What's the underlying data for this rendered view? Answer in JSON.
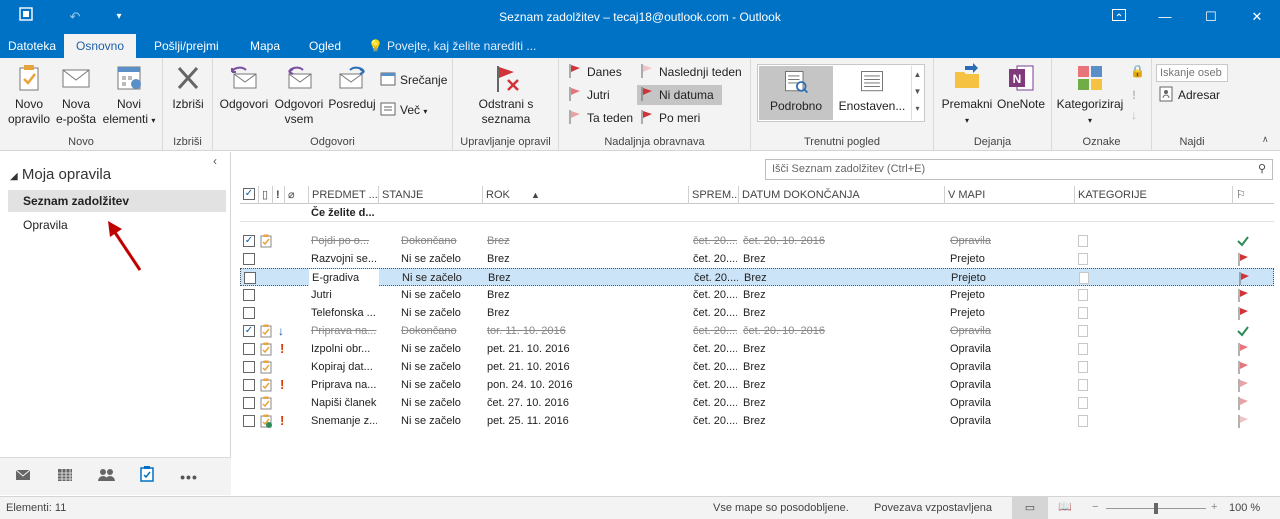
{
  "window": {
    "title": "Seznam zadolžitev – tecaj18@outlook.com - Outlook",
    "controls": [
      "restore-ribbon",
      "minimize",
      "maximize",
      "close"
    ]
  },
  "tabs": [
    "Datoteka",
    "Osnovno",
    "Pošlji/prejmi",
    "Mapa",
    "Ogled"
  ],
  "active_tab": "Osnovno",
  "tellme": "Povejte, kaj želite narediti ...",
  "ribbon": {
    "novo": {
      "label": "Novo",
      "new_task": "Novo opravilo",
      "new_task_1": "Novo",
      "new_task_2": "opravilo",
      "new_email_1": "Nova",
      "new_email_2": "e-pošta",
      "new_items_1": "Novi",
      "new_items_2": "elementi"
    },
    "izbrisi": {
      "label": "Izbriši",
      "delete": "Izbriši"
    },
    "odgovori": {
      "label": "Odgovori",
      "reply": "Odgovori",
      "reply_all_1": "Odgovori",
      "reply_all_2": "vsem",
      "forward": "Posreduj",
      "meeting": "Srečanje",
      "more": "Več"
    },
    "upravljanje": {
      "label": "Upravljanje opravil",
      "remove_1": "Odstrani s",
      "remove_2": "seznama"
    },
    "nadaljnja": {
      "label": "Nadaljnja obravnava",
      "today": "Danes",
      "tomorrow": "Jutri",
      "this_week": "Ta teden",
      "next_week": "Naslednji teden",
      "no_date": "Ni datuma",
      "custom": "Po meri"
    },
    "pogled": {
      "label": "Trenutni pogled",
      "detailed": "Podrobno",
      "simple": "Enostaven..."
    },
    "dejanja": {
      "label": "Dejanja",
      "move": "Premakni",
      "onenote": "OneNote"
    },
    "oznake": {
      "label": "Oznake",
      "categorize": "Kategoriziraj"
    },
    "najdi": {
      "label": "Najdi",
      "search_people_placeholder": "Iskanje oseb",
      "address_book": "Adresar"
    }
  },
  "leftnav": {
    "header": "Moja opravila",
    "items": [
      "Seznam zadolžitev",
      "Opravila"
    ],
    "selected": "Seznam zadolžitev",
    "bottom_icons": [
      "mail-icon",
      "calendar-icon",
      "people-icon",
      "tasks-icon",
      "more-icon"
    ]
  },
  "search": {
    "placeholder": "Išči Seznam zadolžitev (Ctrl+E)"
  },
  "table": {
    "columns": [
      "PREDMET ...",
      "STANJE",
      "ROK",
      "SPREM...",
      "DATUM DOKONČANJA",
      "V MAPI",
      "KATEGORIJE"
    ],
    "new_row_placeholder": "Če želite d...",
    "rows": [
      {
        "subject": "Pojdi po o...",
        "status": "Dokončano",
        "due": "Brez",
        "modified": "čet. 20....",
        "completed": "čet. 20. 10. 2016",
        "folder": "Opravila",
        "done": true,
        "checked": true,
        "importance": "",
        "flag": "check",
        "flag_color": "#2e8b57"
      },
      {
        "subject": "Razvojni se...",
        "status": "Ni se začelo",
        "due": "Brez",
        "modified": "čet. 20....",
        "completed": "Brez",
        "folder": "Prejeto",
        "done": false,
        "checked": false,
        "importance": "",
        "flag": "flag",
        "flag_color": "#d13438",
        "mail": true
      },
      {
        "subject": "E-gradiva",
        "status": "Ni se začelo",
        "due": "Brez",
        "modified": "čet. 20....",
        "completed": "Brez",
        "folder": "Prejeto",
        "done": false,
        "checked": false,
        "importance": "",
        "flag": "flag",
        "flag_color": "#d13438",
        "selected": true,
        "mail": true
      },
      {
        "subject": "Jutri",
        "status": "Ni se začelo",
        "due": "Brez",
        "modified": "čet. 20....",
        "completed": "Brez",
        "folder": "Prejeto",
        "done": false,
        "checked": false,
        "importance": "",
        "flag": "flag",
        "flag_color": "#d13438",
        "mail": true
      },
      {
        "subject": "Telefonska ...",
        "status": "Ni se začelo",
        "due": "Brez",
        "modified": "čet. 20....",
        "completed": "Brez",
        "folder": "Prejeto",
        "done": false,
        "checked": false,
        "importance": "",
        "flag": "flag",
        "flag_color": "#d13438",
        "mail": true
      },
      {
        "subject": "Priprava na...",
        "status": "Dokončano",
        "due": "tor. 11. 10. 2016",
        "modified": "čet. 20....",
        "completed": "čet. 20. 10. 2016",
        "folder": "Opravila",
        "done": true,
        "checked": true,
        "importance": "low",
        "flag": "check",
        "flag_color": "#2e8b57"
      },
      {
        "subject": "Izpolni obr...",
        "status": "Ni se začelo",
        "due": "pet. 21. 10. 2016",
        "modified": "čet. 20....",
        "completed": "Brez",
        "folder": "Opravila",
        "done": false,
        "checked": false,
        "importance": "high",
        "flag": "flag",
        "flag_color": "#e8757a"
      },
      {
        "subject": "Kopiraj dat...",
        "status": "Ni se začelo",
        "due": "pet. 21. 10. 2016",
        "modified": "čet. 20....",
        "completed": "Brez",
        "folder": "Opravila",
        "done": false,
        "checked": false,
        "importance": "",
        "flag": "flag",
        "flag_color": "#e8757a"
      },
      {
        "subject": "Priprava na...",
        "status": "Ni se začelo",
        "due": "pon. 24. 10. 2016",
        "modified": "čet. 20....",
        "completed": "Brez",
        "folder": "Opravila",
        "done": false,
        "checked": false,
        "importance": "high",
        "flag": "flag",
        "flag_color": "#e8a3a6"
      },
      {
        "subject": "Napiši članek",
        "status": "Ni se začelo",
        "due": "čet. 27. 10. 2016",
        "modified": "čet. 20....",
        "completed": "Brez",
        "folder": "Opravila",
        "done": false,
        "checked": false,
        "importance": "",
        "flag": "flag",
        "flag_color": "#e8a3a6"
      },
      {
        "subject": "Snemanje z...",
        "status": "Ni se začelo",
        "due": "pet. 25. 11. 2016",
        "modified": "čet. 20....",
        "completed": "Brez",
        "folder": "Opravila",
        "done": false,
        "checked": false,
        "importance": "high",
        "flag": "flag",
        "flag_color": "#f0c4c6",
        "assigned": true
      }
    ]
  },
  "statusbar": {
    "count": "Elementi: 11",
    "sync": "Vse mape so posodobljene.",
    "connection": "Povezava vzpostavljena",
    "zoom": "100 %"
  },
  "colors": {
    "accent": "#0072c6",
    "selected_row": "#cce4f7",
    "annotation_arrow": "#c00000"
  }
}
